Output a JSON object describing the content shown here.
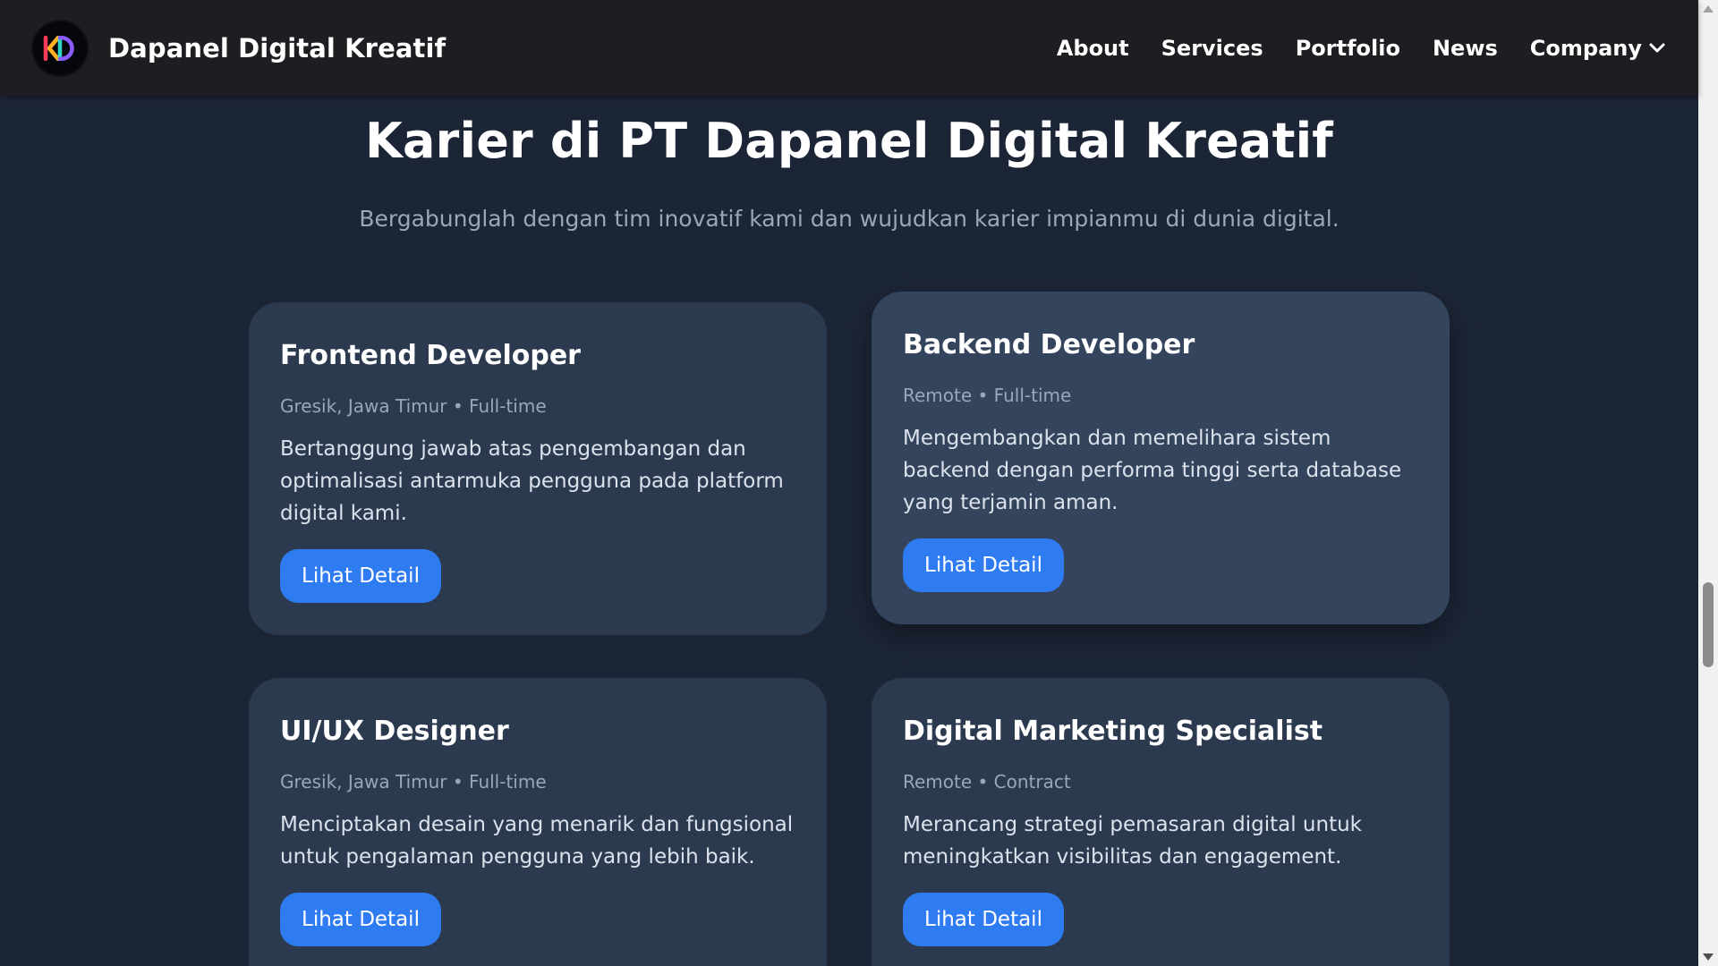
{
  "header": {
    "brand_name": "Dapanel Digital Kreatif",
    "logo_text": "KD",
    "nav": [
      {
        "label": "About"
      },
      {
        "label": "Services"
      },
      {
        "label": "Portfolio"
      },
      {
        "label": "News"
      },
      {
        "label": "Company",
        "icon": "chevron-down-icon"
      }
    ]
  },
  "hero": {
    "title": "Karier di PT Dapanel Digital Kreatif",
    "subtitle": "Bergabunglah dengan tim inovatif kami dan wujudkan karier impianmu di dunia digital."
  },
  "jobs": [
    {
      "title": "Frontend Developer",
      "meta": "Gresik, Jawa Timur • Full-time",
      "description": "Bertanggung jawab atas pengembangan dan optimalisasi antarmuka pengguna pada platform digital kami.",
      "button": "Lihat Detail"
    },
    {
      "title": "Backend Developer",
      "meta": "Remote • Full-time",
      "description": "Mengembangkan dan memelihara sistem backend dengan performa tinggi serta database yang terjamin aman.",
      "button": "Lihat Detail"
    },
    {
      "title": "UI/UX Designer",
      "meta": "Gresik, Jawa Timur • Full-time",
      "description": "Menciptakan desain yang menarik dan fungsional untuk pengalaman pengguna yang lebih baik.",
      "button": "Lihat Detail"
    },
    {
      "title": "Digital Marketing Specialist",
      "meta": "Remote • Contract",
      "description": "Merancang strategi pemasaran digital untuk meningkatkan visibilitas dan engagement.",
      "button": "Lihat Detail"
    }
  ],
  "colors": {
    "page_bg": "#1c2536",
    "header_bg": "#1d1e22",
    "card_bg": "#2b3a4f",
    "card_bg_hover": "#33445c",
    "accent": "#2f7bf2",
    "muted_text": "#9aa7b9"
  }
}
